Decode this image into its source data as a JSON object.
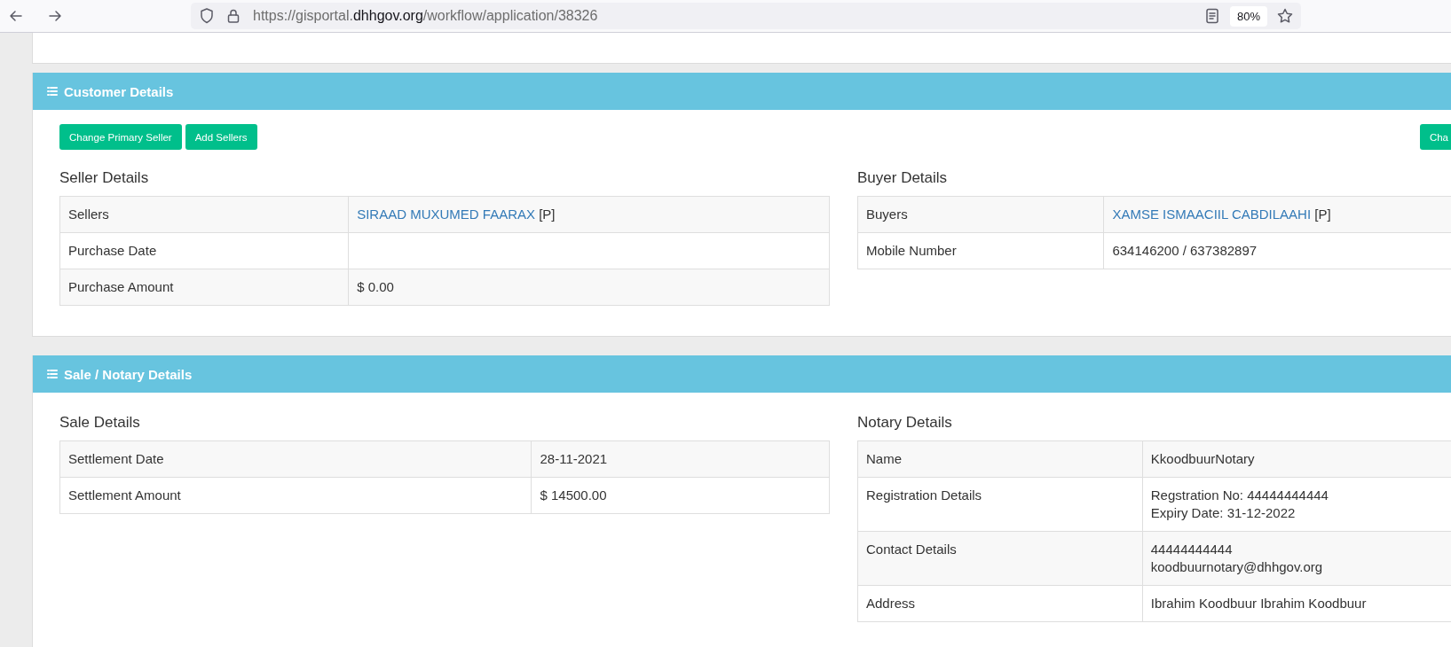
{
  "browser": {
    "url": {
      "prefix": "https://gisportal.",
      "domain": "dhhgov.org",
      "path": "/workflow/application/38326"
    },
    "zoom": "80%"
  },
  "sections": [
    {
      "title": "Customer Details",
      "buttons_left": [
        "Change Primary Seller",
        "Add Sellers"
      ],
      "buttons_right": [
        "Cha"
      ],
      "panels": [
        {
          "title": "Seller Details",
          "rows": [
            {
              "label": "Sellers",
              "value": {
                "kind": "link",
                "text": "SIRAAD MUXUMED FAARAX",
                "suffix": "[P]"
              }
            },
            {
              "label": "Purchase Date"
            },
            {
              "label": "Purchase Amount",
              "value": {
                "kind": "text",
                "lines": [
                  "$ 0.00"
                ]
              }
            }
          ]
        },
        {
          "title": "Buyer Details",
          "rows": [
            {
              "label": "Buyers",
              "value": {
                "kind": "link",
                "text": "XAMSE ISMAACIIL CABDILAAHI",
                "suffix": "[P]"
              }
            },
            {
              "label": "Mobile Number",
              "value": {
                "kind": "text",
                "lines": [
                  "634146200 / 637382897"
                ]
              }
            }
          ]
        }
      ]
    },
    {
      "title": "Sale / Notary Details",
      "panels": [
        {
          "title": "Sale Details",
          "rows": [
            {
              "label": "Settlement Date",
              "value": {
                "kind": "text",
                "lines": [
                  "28-11-2021"
                ]
              }
            },
            {
              "label": "Settlement Amount",
              "value": {
                "kind": "text",
                "lines": [
                  "$ 14500.00"
                ]
              }
            }
          ]
        },
        {
          "title": "Notary Details",
          "rows": [
            {
              "label": "Name",
              "value": {
                "kind": "text",
                "lines": [
                  "KkoodbuurNotary"
                ]
              }
            },
            {
              "label": "Registration Details",
              "value": {
                "kind": "text",
                "lines": [
                  "Regstration No: 44444444444",
                  "Expiry Date: 31-12-2022"
                ]
              }
            },
            {
              "label": "Contact Details",
              "value": {
                "kind": "text",
                "lines": [
                  "44444444444",
                  "koodbuurnotary@dhhgov.org"
                ]
              }
            },
            {
              "label": "Address",
              "value": {
                "kind": "text",
                "lines": [
                  "Ibrahim Koodbuur Ibrahim Koodbuur"
                ]
              }
            }
          ]
        }
      ]
    }
  ]
}
